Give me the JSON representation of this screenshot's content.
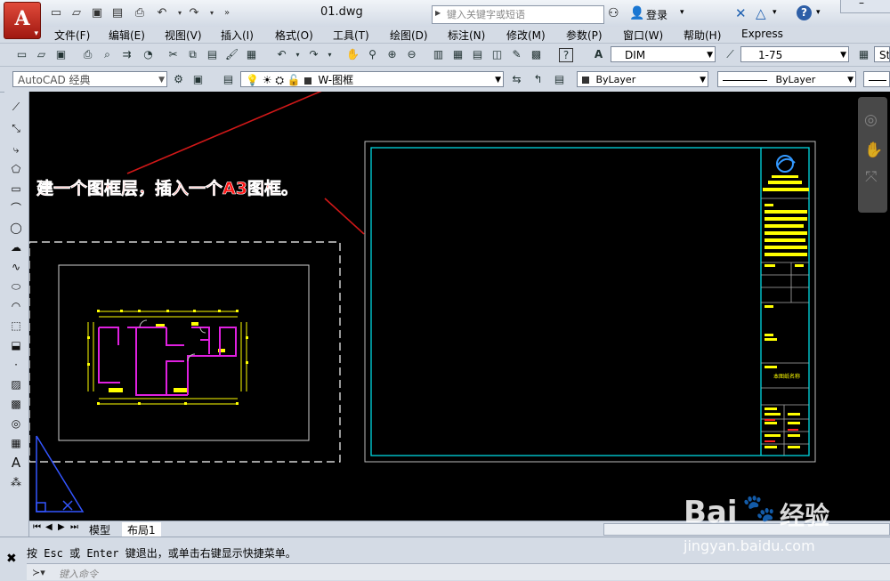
{
  "title_bar": {
    "doc_title": "01.dwg",
    "search_placeholder": "键入关键字或短语",
    "login_label": "登录"
  },
  "menu": [
    "文件(F)",
    "编辑(E)",
    "视图(V)",
    "插入(I)",
    "格式(O)",
    "工具(T)",
    "绘图(D)",
    "标注(N)",
    "修改(M)",
    "参数(P)",
    "窗口(W)",
    "帮助(H)",
    "Express"
  ],
  "toolbar1": {
    "dim_style": "DIM",
    "scale": "1-75",
    "text_style_partial": "Sta"
  },
  "toolbar2": {
    "workspace": "AutoCAD 经典",
    "layer": "W-图框",
    "color": "ByLayer",
    "linetype": "ByLayer"
  },
  "annotation": {
    "text": "建一个图框层，插入一个A3图框。"
  },
  "drawing": {
    "title_block_caption": "本图纸名称"
  },
  "layout_tabs": {
    "model": "模型",
    "layout1": "布局1"
  },
  "command": {
    "history": "按 Esc 或 Enter 键退出，或单击右键显示快捷菜单。",
    "prompt": "键入命令"
  },
  "watermark": {
    "brand": "Bai",
    "brand_cn": "经验",
    "url": "jingyan.baidu.com"
  },
  "colors": {
    "canvas": "#000000",
    "layer_frame": "#00d8e0",
    "walls": "#e020e0",
    "dims": "#ffff00",
    "annotation_text": "#ff1414",
    "leader": "#d01818"
  }
}
